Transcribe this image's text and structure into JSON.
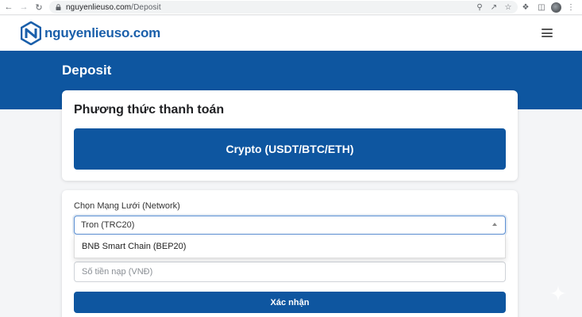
{
  "browser": {
    "url_domain": "nguyenlieuso.com",
    "url_path": "/Deposit",
    "back_icon": "arrow-left",
    "forward_icon": "arrow-right",
    "reload_icon": "reload"
  },
  "header": {
    "logo_text": "nguyenlieuso.com",
    "brand_color": "#1a5faa"
  },
  "page": {
    "title": "Deposit",
    "band_color": "#0e56a0"
  },
  "payment": {
    "title": "Phương thức thanh toán",
    "method_label": "Crypto (USDT/BTC/ETH)"
  },
  "form": {
    "network_label": "Chọn Mạng Lưới (Network)",
    "network_selected": "Tron (TRC20)",
    "network_options": [
      "BNB Smart Chain (BEP20)"
    ],
    "amount_placeholder": "Số tiền nạp (VNĐ)",
    "submit_label": "Xác nhận"
  }
}
